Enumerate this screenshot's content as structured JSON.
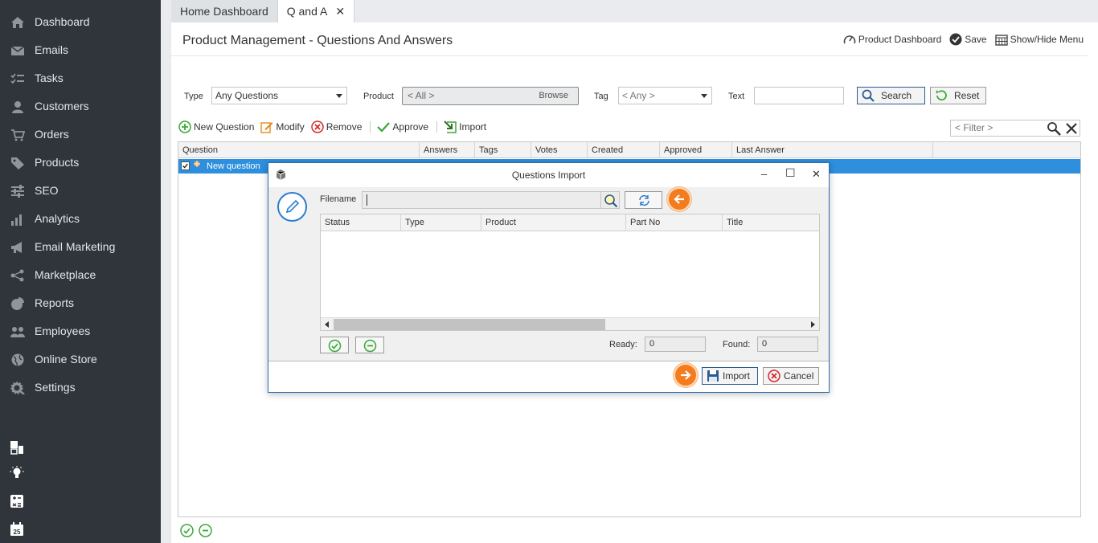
{
  "sidebar": {
    "items": [
      {
        "label": "Dashboard",
        "icon": "home-icon"
      },
      {
        "label": "Emails",
        "icon": "envelope-icon"
      },
      {
        "label": "Tasks",
        "icon": "tasks-icon"
      },
      {
        "label": "Customers",
        "icon": "user-icon"
      },
      {
        "label": "Orders",
        "icon": "cart-icon"
      },
      {
        "label": "Products",
        "icon": "tag-icon"
      },
      {
        "label": "SEO",
        "icon": "sliders-icon"
      },
      {
        "label": "Analytics",
        "icon": "bar-chart-icon"
      },
      {
        "label": "Email Marketing",
        "icon": "megaphone-icon"
      },
      {
        "label": "Marketplace",
        "icon": "share-icon"
      },
      {
        "label": "Reports",
        "icon": "pie-chart-icon"
      },
      {
        "label": "Employees",
        "icon": "users-icon"
      },
      {
        "label": "Online Store",
        "icon": "globe-icon"
      },
      {
        "label": "Settings",
        "icon": "gear-icon"
      }
    ],
    "calendar_day": "25"
  },
  "tabs": [
    {
      "label": "Home Dashboard"
    },
    {
      "label": "Q and A",
      "close": "✕"
    }
  ],
  "page": {
    "title": "Product Management - Questions And Answers",
    "actions": {
      "dashboard": "Product Dashboard",
      "save": "Save",
      "menu": "Show/Hide Menu"
    }
  },
  "filters": {
    "type_label": "Type",
    "type_value": "Any Questions",
    "product_label": "Product",
    "product_value": "< All >",
    "browse": "Browse",
    "tag_label": "Tag",
    "tag_value": "< Any >",
    "text_label": "Text",
    "search": "Search",
    "reset": "Reset"
  },
  "toolbar": {
    "new": "New Question",
    "modify": "Modify",
    "remove": "Remove",
    "approve": "Approve",
    "import": "Import",
    "filter_placeholder": "< Filter >"
  },
  "grid": {
    "columns": [
      "Question",
      "Answers",
      "Tags",
      "Votes",
      "Created",
      "Approved",
      "Last Answer"
    ],
    "rows": [
      {
        "question": "New question"
      }
    ]
  },
  "dialog": {
    "title": "Questions Import",
    "filename_label": "Filename",
    "columns": [
      "Status",
      "Type",
      "Product",
      "Part No",
      "Title"
    ],
    "ready_label": "Ready:",
    "ready_value": "0",
    "found_label": "Found:",
    "found_value": "0",
    "import": "Import",
    "cancel": "Cancel",
    "minimize": "–",
    "maximize": "☐",
    "close": "✕"
  },
  "colors": {
    "sidebar_bg": "#2f353b",
    "selection": "#2d8fdd",
    "accent_orange": "#f37c1e",
    "accent_green": "#3aa935",
    "accent_red": "#d9262b",
    "dialog_border": "#2d6db1"
  }
}
